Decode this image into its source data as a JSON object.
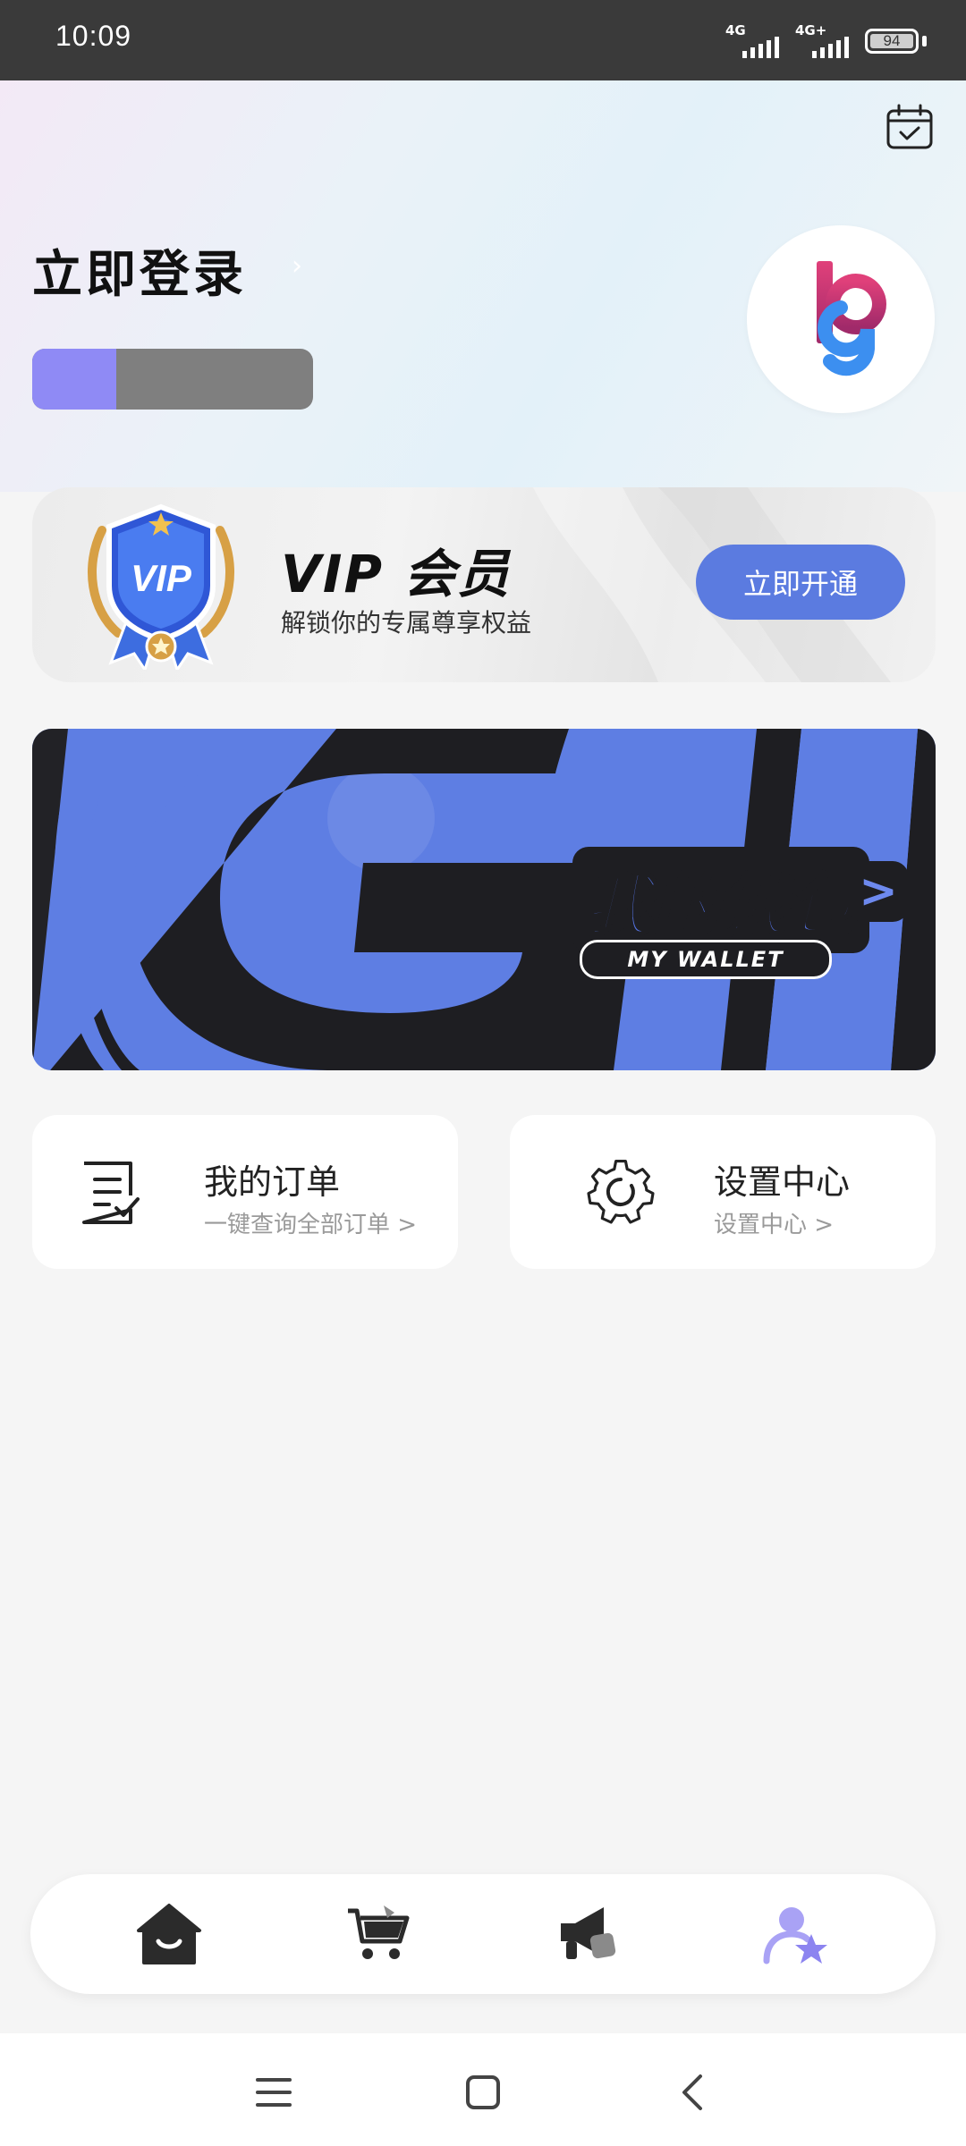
{
  "status_bar": {
    "time": "10:09",
    "net1": "4G",
    "net2": "4G+",
    "battery": "94"
  },
  "header": {
    "login_label": "立即登录",
    "login_chevron": "›",
    "progress_fraction": 0.3,
    "calendar_icon": "calendar-check-icon",
    "avatar_icon": "bg-logo-icon"
  },
  "vip": {
    "badge_text": "VIP",
    "title": "VIP 会员",
    "subtitle": "解锁你的专属尊享权益",
    "button": "立即开通"
  },
  "wallet": {
    "title": "我的钱包",
    "arrow": ">",
    "subtitle": "MY WALLET"
  },
  "cards": {
    "orders": {
      "title": "我的订单",
      "subtitle": "一键查询全部订单 >",
      "icon": "order-list-icon"
    },
    "settings": {
      "title": "设置中心",
      "subtitle": "设置中心 >",
      "icon": "gear-icon"
    }
  },
  "tabs": [
    {
      "icon": "home-icon",
      "active": false
    },
    {
      "icon": "cart-icon",
      "active": false
    },
    {
      "icon": "megaphone-icon",
      "active": false
    },
    {
      "icon": "user-star-icon",
      "active": true
    }
  ],
  "colors": {
    "accent": "#5b7be0",
    "progress": "#8f8af5",
    "active_tab": "#8c84f0",
    "wallet_blue": "#5e7ee3"
  }
}
